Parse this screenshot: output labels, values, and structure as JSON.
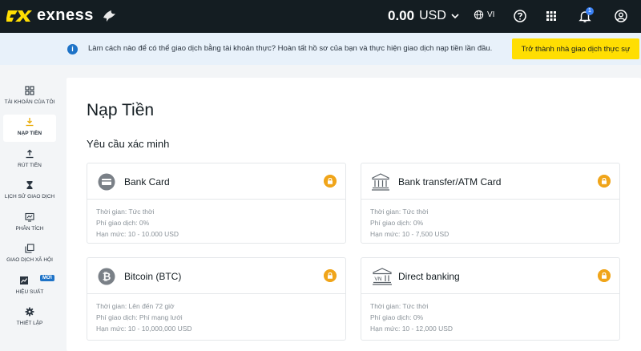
{
  "header": {
    "brand": "exness",
    "balance_value": "0.00",
    "balance_currency": "USD",
    "language": "VI",
    "notification_count": "1"
  },
  "banner": {
    "text": "Làm cách nào để có thể giao dịch bằng tài khoản thực? Hoàn tất hồ sơ của bạn và thực hiện giao dịch nạp tiền lần đầu.",
    "button_label": "Trở thành nhà giao dịch thực sự"
  },
  "sidebar": {
    "items": [
      {
        "label": "Tài khoản của tôi",
        "icon": "grid-icon"
      },
      {
        "label": "Nạp tiền",
        "icon": "download-icon"
      },
      {
        "label": "Rút tiền",
        "icon": "upload-icon"
      },
      {
        "label": "Lịch sử giao dịch",
        "icon": "hourglass-icon"
      },
      {
        "label": "Phân tích",
        "icon": "chart-icon"
      },
      {
        "label": "Giao dịch xã hội",
        "icon": "copy-icon"
      },
      {
        "label": "Hiệu suất",
        "icon": "performance-icon",
        "badge": "MỚI"
      },
      {
        "label": "Thiết lập",
        "icon": "gear-icon"
      }
    ]
  },
  "main": {
    "title": "Nạp Tiền",
    "section_title": "Yêu cầu xác minh",
    "cards": [
      {
        "title": "Bank Card",
        "icon": "credit-card-icon",
        "time": "Thời gian: Tức thời",
        "fee": "Phí giao dịch: 0%",
        "limit": "Hạn mức: 10 - 10.000 USD"
      },
      {
        "title": "Bank transfer/ATM Card",
        "icon": "bank-icon",
        "time": "Thời gian: Tức thời",
        "fee": "Phí giao dịch: 0%",
        "limit": "Hạn mức: 10 - 7,500 USD"
      },
      {
        "title": "Bitcoin (BTC)",
        "icon": "bitcoin-icon",
        "time": "Thời gian: Lên đến 72 giờ",
        "fee": "Phí giao dịch: Phí mạng lưới",
        "limit": "Hạn mức: 10 - 10,000,000 USD"
      },
      {
        "title": "Direct banking",
        "icon": "bank-vn-icon",
        "icon_text": "VN",
        "time": "Thời gian: Tức thời",
        "fee": "Phí giao dịch: 0%",
        "limit": "Hạn mức: 10 - 12,000 USD"
      }
    ]
  },
  "colors": {
    "topbar": "#141d22",
    "accent_yellow": "#ffde02",
    "lock_orange": "#f0a51a",
    "info_blue": "#1e73c7",
    "banner_bg": "#e8f1fa"
  }
}
